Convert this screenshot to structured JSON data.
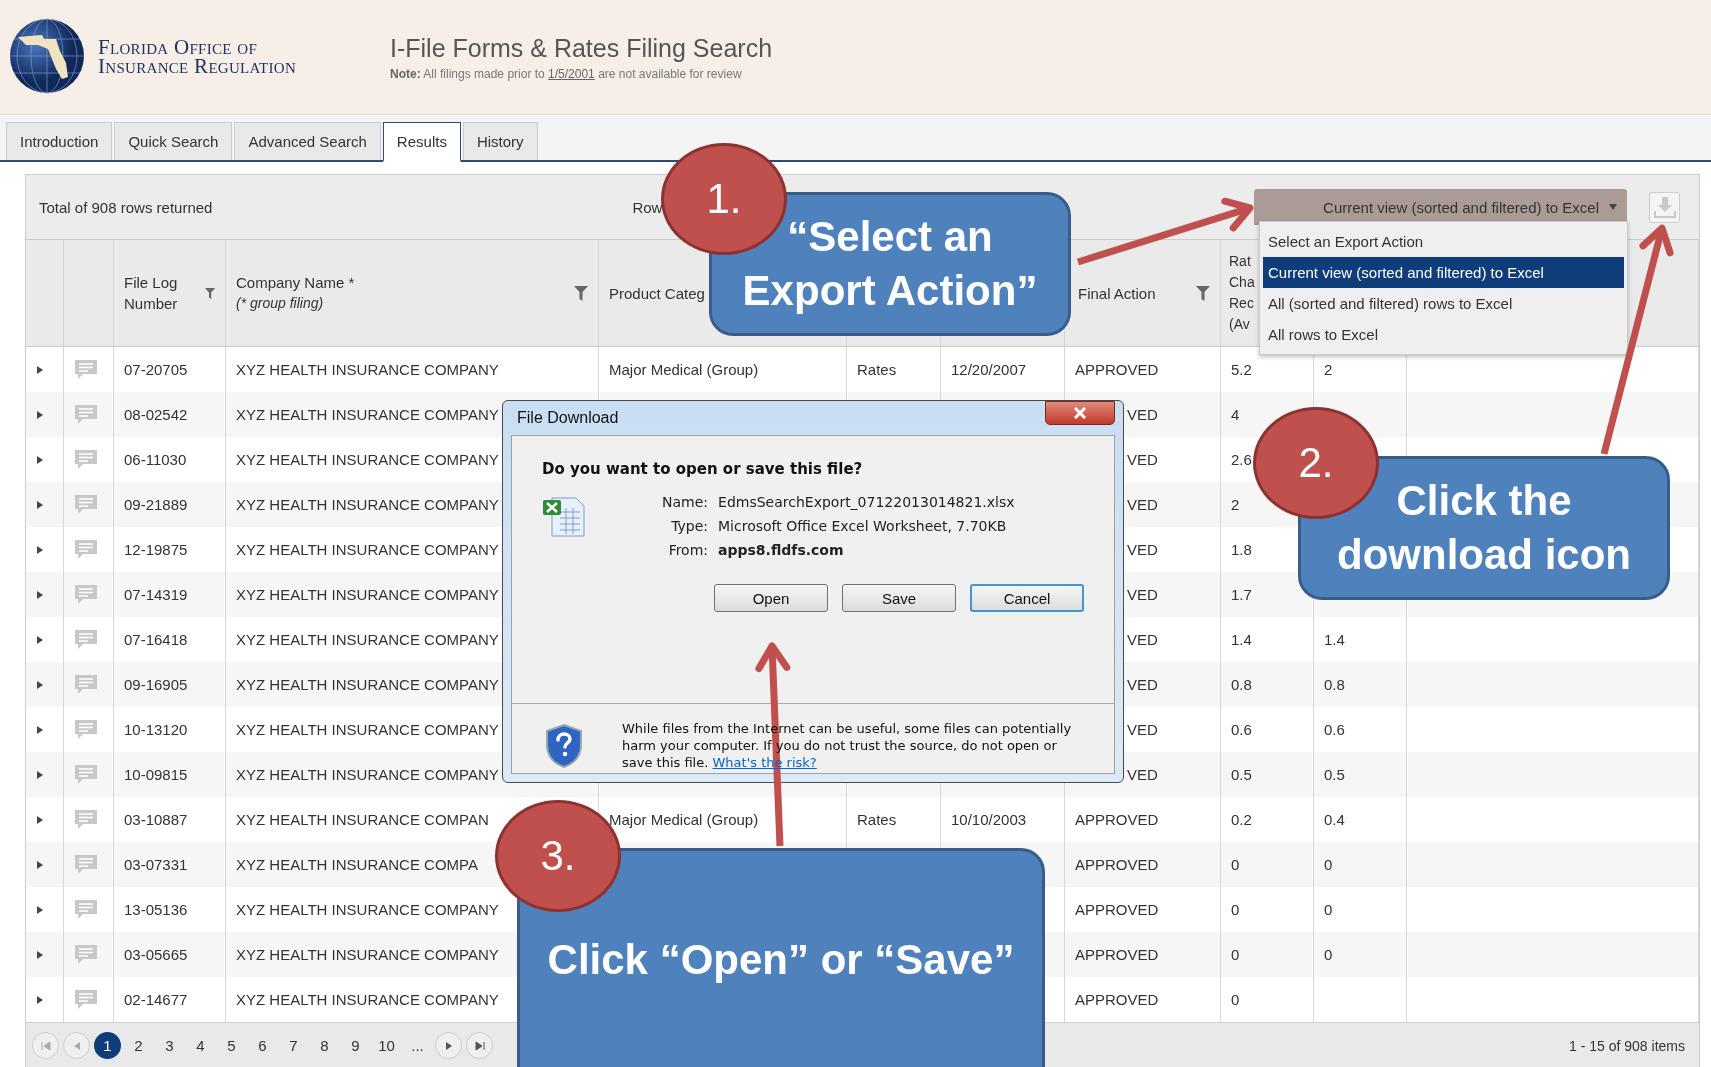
{
  "header": {
    "logo_lines": [
      "Florida Office of",
      "Insurance Regulation"
    ],
    "title": "I-File Forms & Rates Filing Search",
    "note": {
      "text": "**Note:** All filings made prior to",
      "link": "1/5/2001",
      "rest": "are not available for review"
    }
  },
  "tabs": [
    {
      "label": "Introduction",
      "selected": false
    },
    {
      "label": "Quick Search",
      "selected": false
    },
    {
      "label": "Advanced Search",
      "selected": false
    },
    {
      "label": "Results",
      "selected": true
    },
    {
      "label": "History",
      "selected": false
    }
  ],
  "toolbar": {
    "total": "Total of 908 rows returned",
    "rows_label": "Row",
    "export": {
      "value": "Current view (sorted and filtered) to Excel",
      "expanded": true,
      "options": [
        {
          "label": "Select an Export Action",
          "selected": false
        },
        {
          "label": "Current view (sorted and filtered) to Excel",
          "selected": true
        },
        {
          "label": "All (sorted and filtered) rows to Excel",
          "selected": false
        },
        {
          "label": "All rows to Excel",
          "selected": false
        }
      ]
    }
  },
  "table": {
    "columns": [
      {
        "kind": "blank"
      },
      {
        "kind": "blank"
      },
      {
        "kind": "text",
        "label": "File Log Number",
        "filter": true
      },
      {
        "kind": "text",
        "label": "Company Name *",
        "sublabel": "(* group filing)",
        "filter": true
      },
      {
        "kind": "text",
        "label": "Product Categ"
      },
      {
        "kind": "blank"
      },
      {
        "kind": "blank"
      },
      {
        "kind": "text",
        "label": "Final Action",
        "filter": true
      },
      {
        "kind": "lines",
        "lines": [
          "Rat",
          "Cha",
          "Rec",
          "(Av"
        ]
      },
      {
        "kind": "blank"
      },
      {
        "kind": "blank"
      }
    ],
    "rows": [
      {
        "expanded": false,
        "covered": false,
        "file_log": "07-20705",
        "company": "XYZ HEALTH INSURANCE COMPANY",
        "product": "Major Medical (Group)",
        "type": "Rates",
        "date": "12/20/2007",
        "final_action": "APPROVED",
        "rate": "5.2",
        "column_10": "2"
      },
      {
        "expanded": false,
        "covered": true,
        "file_log": "08-02542",
        "company": "XYZ HEALTH INSURANCE COMPANY",
        "final_action": "VED",
        "rate": "4"
      },
      {
        "expanded": false,
        "covered": true,
        "file_log": "06-11030",
        "company": "XYZ HEALTH INSURANCE COMPANY",
        "final_action": "VED",
        "rate": "2.6"
      },
      {
        "expanded": false,
        "covered": true,
        "file_log": "09-21889",
        "company": "XYZ HEALTH INSURANCE COMPANY",
        "final_action": "VED",
        "rate": "2"
      },
      {
        "expanded": false,
        "covered": true,
        "file_log": "12-19875",
        "company": "XYZ HEALTH INSURANCE COMPANY",
        "final_action": "VED",
        "rate": "1.8"
      },
      {
        "expanded": false,
        "covered": true,
        "file_log": "07-14319",
        "company": "XYZ HEALTH INSURANCE COMPANY",
        "final_action": "VED",
        "rate": "1.7"
      },
      {
        "expanded": false,
        "covered": true,
        "file_log": "07-16418",
        "company": "XYZ HEALTH INSURANCE COMPANY",
        "final_action": "VED",
        "rate": "1.4",
        "column_10": "1.4"
      },
      {
        "expanded": false,
        "covered": true,
        "file_log": "09-16905",
        "company": "XYZ HEALTH INSURANCE COMPANY",
        "final_action": "VED",
        "rate": "0.8",
        "column_10": "0.8"
      },
      {
        "expanded": false,
        "covered": true,
        "file_log": "10-13120",
        "company": "XYZ HEALTH INSURANCE COMPANY",
        "final_action": "VED",
        "rate": "0.6",
        "column_10": "0.6"
      },
      {
        "expanded": false,
        "covered": true,
        "file_log": "10-09815",
        "company": "XYZ HEALTH INSURANCE COMPANY",
        "final_action": "VED",
        "rate": "0.5",
        "column_10": "0.5"
      },
      {
        "expanded": false,
        "covered": false,
        "file_log": "03-10887",
        "company": "XYZ HEALTH INSURANCE COMPAN",
        "product": "Major Medical (Group)",
        "type": "Rates",
        "date": "10/10/2003",
        "final_action": "APPROVED",
        "rate": "0.2",
        "column_10": "0.4"
      },
      {
        "expanded": false,
        "covered": false,
        "file_log": "03-07331",
        "company": "XYZ HEALTH INSURANCE COMPA",
        "final_action": "APPROVED",
        "rate": "0",
        "column_10": "0"
      },
      {
        "expanded": false,
        "covered": false,
        "file_log": "13-05136",
        "company": "XYZ HEALTH INSURANCE COMPANY",
        "final_action": "APPROVED",
        "rate": "0",
        "column_10": "0"
      },
      {
        "expanded": false,
        "covered": false,
        "file_log": "03-05665",
        "company": "XYZ HEALTH INSURANCE COMPANY",
        "final_action": "APPROVED",
        "rate": "0",
        "column_10": "0"
      },
      {
        "expanded": false,
        "covered": false,
        "file_log": "02-14677",
        "company": "XYZ HEALTH INSURANCE COMPANY",
        "final_action": "APPROVED",
        "rate": "0"
      }
    ]
  },
  "pager": {
    "pages": [
      {
        "label": "1",
        "selected": true
      },
      {
        "label": "2",
        "selected": false
      },
      {
        "label": "3",
        "selected": false
      },
      {
        "label": "4",
        "selected": false
      },
      {
        "label": "5",
        "selected": false
      },
      {
        "label": "6",
        "selected": false
      },
      {
        "label": "7",
        "selected": false
      },
      {
        "label": "8",
        "selected": false
      },
      {
        "label": "9",
        "selected": false
      },
      {
        "label": "10",
        "selected": false
      },
      {
        "label": "...",
        "selected": false
      }
    ],
    "summary": "1 - 15 of 908 items"
  },
  "dialog": {
    "title": "File Download",
    "question": "Do you want to open or save this file?",
    "fields": [
      {
        "label": "Name:",
        "value": "EdmsSearchExport_07122013014821.xlsx",
        "bold": false
      },
      {
        "label": "Type:",
        "value": "Microsoft Office Excel Worksheet, 7.70KB",
        "bold": false
      },
      {
        "label": "From:",
        "value": "apps8.fldfs.com",
        "bold": true
      }
    ],
    "buttons": [
      {
        "label": "Open",
        "focused": false
      },
      {
        "label": "Save",
        "focused": false
      },
      {
        "label": "Cancel",
        "focused": true
      }
    ],
    "warning": "While files from the Internet can be useful, some files can potentially harm your computer. If you do not trust the source, do not open or save this file.",
    "warning_link": "What's the risk?"
  },
  "callouts": [
    {
      "number": "1.",
      "text": "“Select an Export Action”"
    },
    {
      "number": "2.",
      "text": "Click the download icon"
    },
    {
      "number": "3.",
      "text": "Click “Open” or “Save”"
    }
  ]
}
